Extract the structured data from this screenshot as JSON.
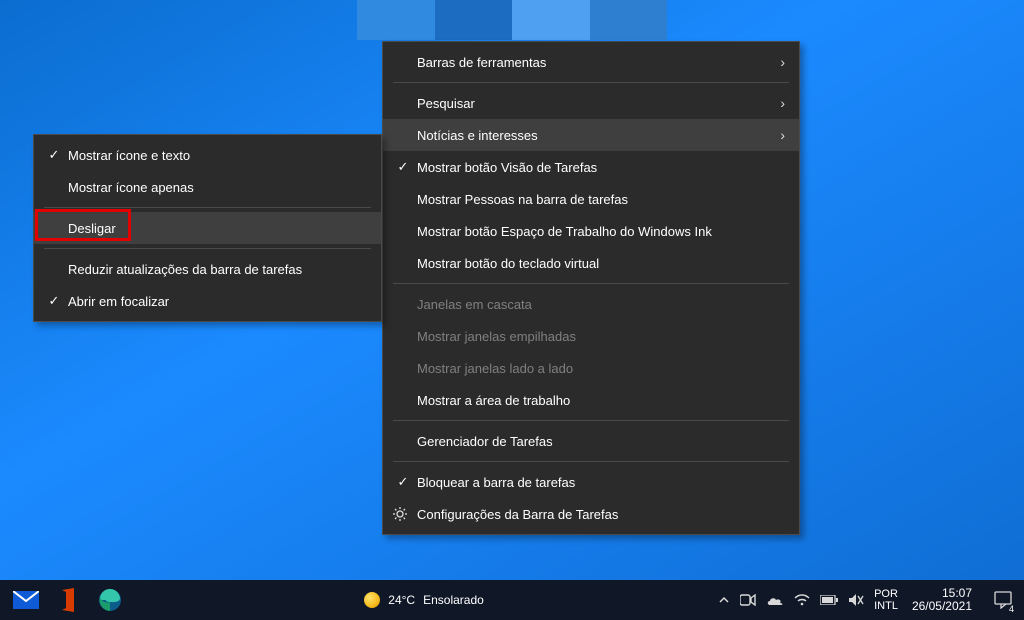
{
  "menu_main": [
    {
      "label": "Barras de ferramentas",
      "arrow": true
    },
    {
      "sep": true
    },
    {
      "label": "Pesquisar",
      "arrow": true
    },
    {
      "label": "Notícias e interesses",
      "arrow": true,
      "hover": true
    },
    {
      "label": "Mostrar botão Visão de Tarefas",
      "check": true
    },
    {
      "label": "Mostrar Pessoas na barra de tarefas"
    },
    {
      "label": "Mostrar botão Espaço de Trabalho do Windows Ink"
    },
    {
      "label": "Mostrar botão do teclado virtual"
    },
    {
      "sep": true
    },
    {
      "label": "Janelas em cascata",
      "disabled": true
    },
    {
      "label": "Mostrar janelas empilhadas",
      "disabled": true
    },
    {
      "label": "Mostrar janelas lado a lado",
      "disabled": true
    },
    {
      "label": "Mostrar a área de trabalho"
    },
    {
      "sep": true
    },
    {
      "label": "Gerenciador de Tarefas"
    },
    {
      "sep": true
    },
    {
      "label": "Bloquear a barra de tarefas",
      "check": true
    },
    {
      "label": "Configurações da Barra de Tarefas",
      "gear": true
    }
  ],
  "menu_sub": [
    {
      "label": "Mostrar ícone e texto",
      "check": true
    },
    {
      "label": "Mostrar ícone apenas"
    },
    {
      "sep": true
    },
    {
      "label": "Desligar",
      "hover": true,
      "boxed": true
    },
    {
      "sep": true
    },
    {
      "label": "Reduzir atualizações da barra de tarefas"
    },
    {
      "label": "Abrir em focalizar",
      "check": true
    }
  ],
  "weather": {
    "temp": "24°C",
    "text": "Ensolarado"
  },
  "lang": {
    "top": "POR",
    "bottom": "INTL"
  },
  "clock": {
    "time": "15:07",
    "date": "26/05/2021"
  },
  "notif_count": "4"
}
